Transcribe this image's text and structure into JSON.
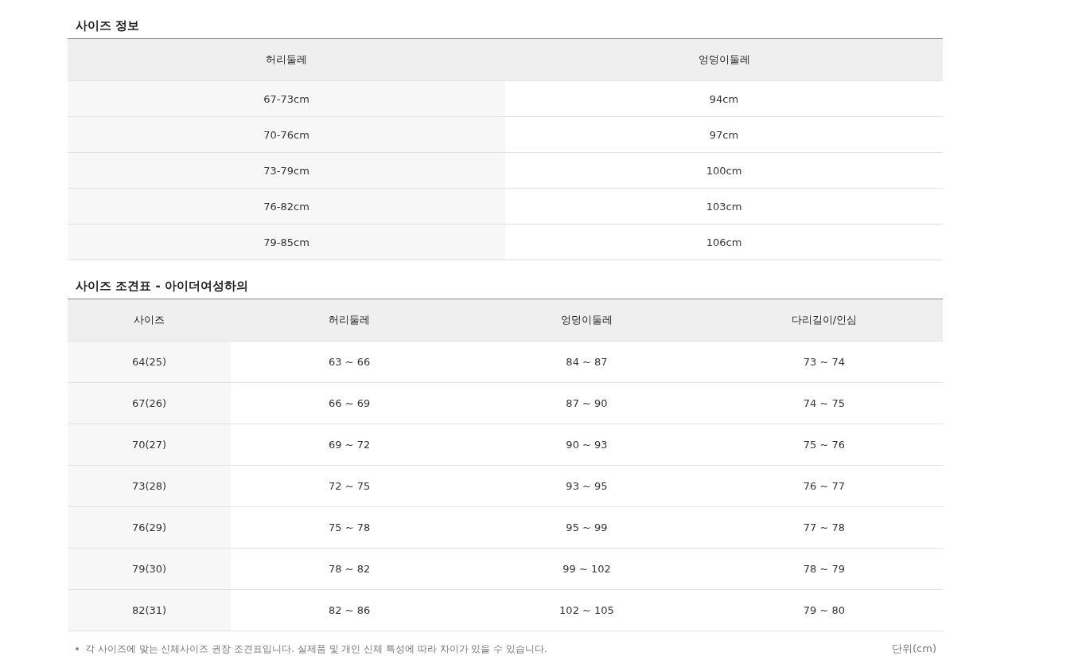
{
  "size_info": {
    "title": "사이즈 정보",
    "columns": [
      "허리둘레",
      "엉덩이둘레"
    ],
    "rows": [
      [
        "67-73cm",
        "94cm"
      ],
      [
        "70-76cm",
        "97cm"
      ],
      [
        "73-79cm",
        "100cm"
      ],
      [
        "76-82cm",
        "103cm"
      ],
      [
        "79-85cm",
        "106cm"
      ]
    ]
  },
  "size_chart": {
    "title": "사이즈 조견표 - 아이더여성하의",
    "columns": [
      "사이즈",
      "허리둘레",
      "엉덩이둘레",
      "다리길이/인심"
    ],
    "rows": [
      [
        "64(25)",
        "63 ~ 66",
        "84 ~ 87",
        "73 ~ 74"
      ],
      [
        "67(26)",
        "66 ~ 69",
        "87 ~ 90",
        "74 ~ 75"
      ],
      [
        "70(27)",
        "69 ~ 72",
        "90 ~ 93",
        "75 ~ 76"
      ],
      [
        "73(28)",
        "72 ~ 75",
        "93 ~ 95",
        "76 ~ 77"
      ],
      [
        "76(29)",
        "75 ~ 78",
        "95 ~ 99",
        "77 ~ 78"
      ],
      [
        "79(30)",
        "78 ~ 82",
        "99 ~ 102",
        "78 ~ 79"
      ],
      [
        "82(31)",
        "82 ~ 86",
        "102 ~ 105",
        "79 ~ 80"
      ]
    ]
  },
  "note": "각 사이즈에 맞는 신체사이즈 권장 조견표입니다. 실제품 및 개인 신체 특성에 따라 차이가 있을 수 있습니다.",
  "unit": "단위(cm)"
}
